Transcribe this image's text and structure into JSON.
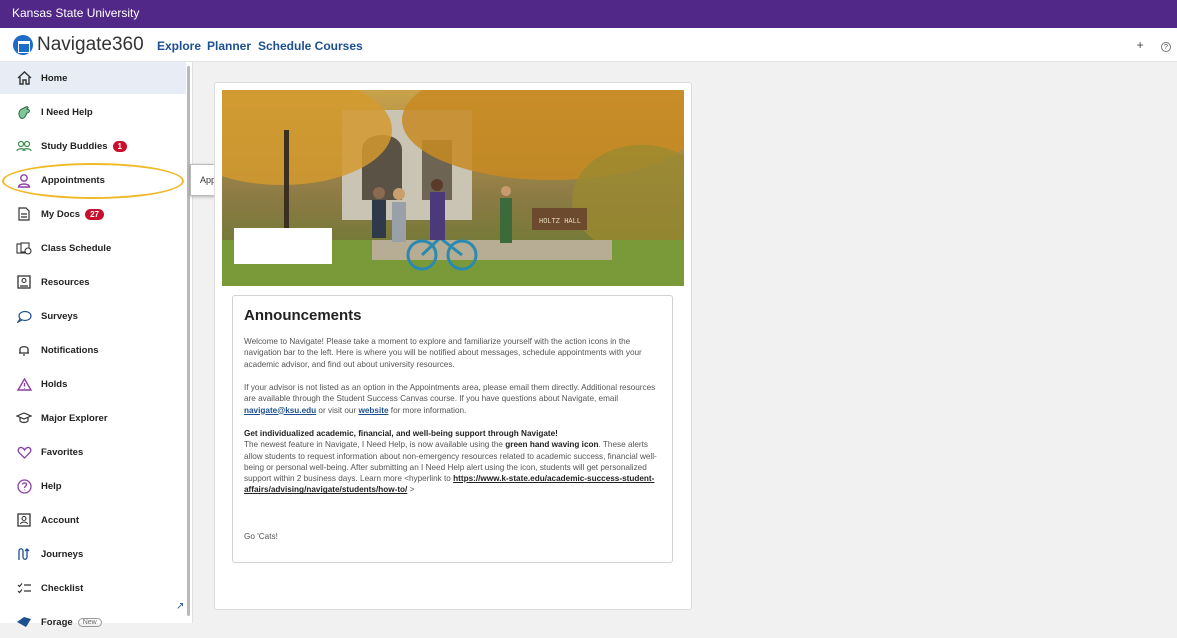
{
  "university_bar": {
    "title": "Kansas State University"
  },
  "topbar": {
    "brand": "Navigate360",
    "nav": [
      "Explore",
      "Planner",
      "Schedule Courses"
    ],
    "plus_icon": "+",
    "help_icon": "?"
  },
  "sidebar": {
    "items": [
      {
        "label": "Home",
        "icon": "home-icon"
      },
      {
        "label": "I Need Help",
        "icon": "hand-wave-icon"
      },
      {
        "label": "Study Buddies",
        "icon": "people-icon",
        "badge": "1"
      },
      {
        "label": "Appointments",
        "icon": "person-icon"
      },
      {
        "label": "My Docs",
        "icon": "document-icon",
        "badge": "27"
      },
      {
        "label": "Class Schedule",
        "icon": "schedule-icon"
      },
      {
        "label": "Resources",
        "icon": "resources-icon"
      },
      {
        "label": "Surveys",
        "icon": "chat-icon"
      },
      {
        "label": "Notifications",
        "icon": "bell-icon"
      },
      {
        "label": "Holds",
        "icon": "warning-icon"
      },
      {
        "label": "Major Explorer",
        "icon": "graduation-cap-icon"
      },
      {
        "label": "Favorites",
        "icon": "heart-icon"
      },
      {
        "label": "Help",
        "icon": "question-icon"
      },
      {
        "label": "Account",
        "icon": "account-icon"
      },
      {
        "label": "Journeys",
        "icon": "journey-icon"
      },
      {
        "label": "Checklist",
        "icon": "checklist-icon"
      },
      {
        "label": "Forage",
        "icon": "forage-icon",
        "tag": "New"
      }
    ],
    "tooltip": "Appointments"
  },
  "hero": {
    "sign": "HOLTZ HALL"
  },
  "announcements": {
    "title": "Announcements",
    "p1": "Welcome to Navigate! Please take a moment to explore and familiarize yourself with the action icons in the navigation bar to the left. Here is where you will be notified about messages, schedule appointments with your academic advisor, and find out about university resources.",
    "p2_a": "If your advisor is not listed as an option in the Appointments area, please email them directly. Additional resources are available through the Student Success Canvas course. If you have questions about Navigate, email ",
    "p2_email": "navigate@ksu.edu",
    "p2_b": " or visit our ",
    "p2_link": "website",
    "p2_c": " for more information.",
    "p3_head": "Get individualized academic, financial, and well-being support through Navigate!",
    "p3_a": "The newest feature in Navigate, I Need Help, is now available using the ",
    "p3_bold": "green hand waving icon",
    "p3_b": ". These alerts allow students to request information about non-emergency resources related to academic success, financial well-being or personal well-being. After submitting an I Need Help alert using the icon, students will get personalized support within 2 business days. Learn more <hyperlink to ",
    "p3_link": "https://www.k-state.edu/academic-success-student-affairs/advising/navigate/students/how-to/",
    "p3_c": " >",
    "signoff": "Go 'Cats!"
  }
}
